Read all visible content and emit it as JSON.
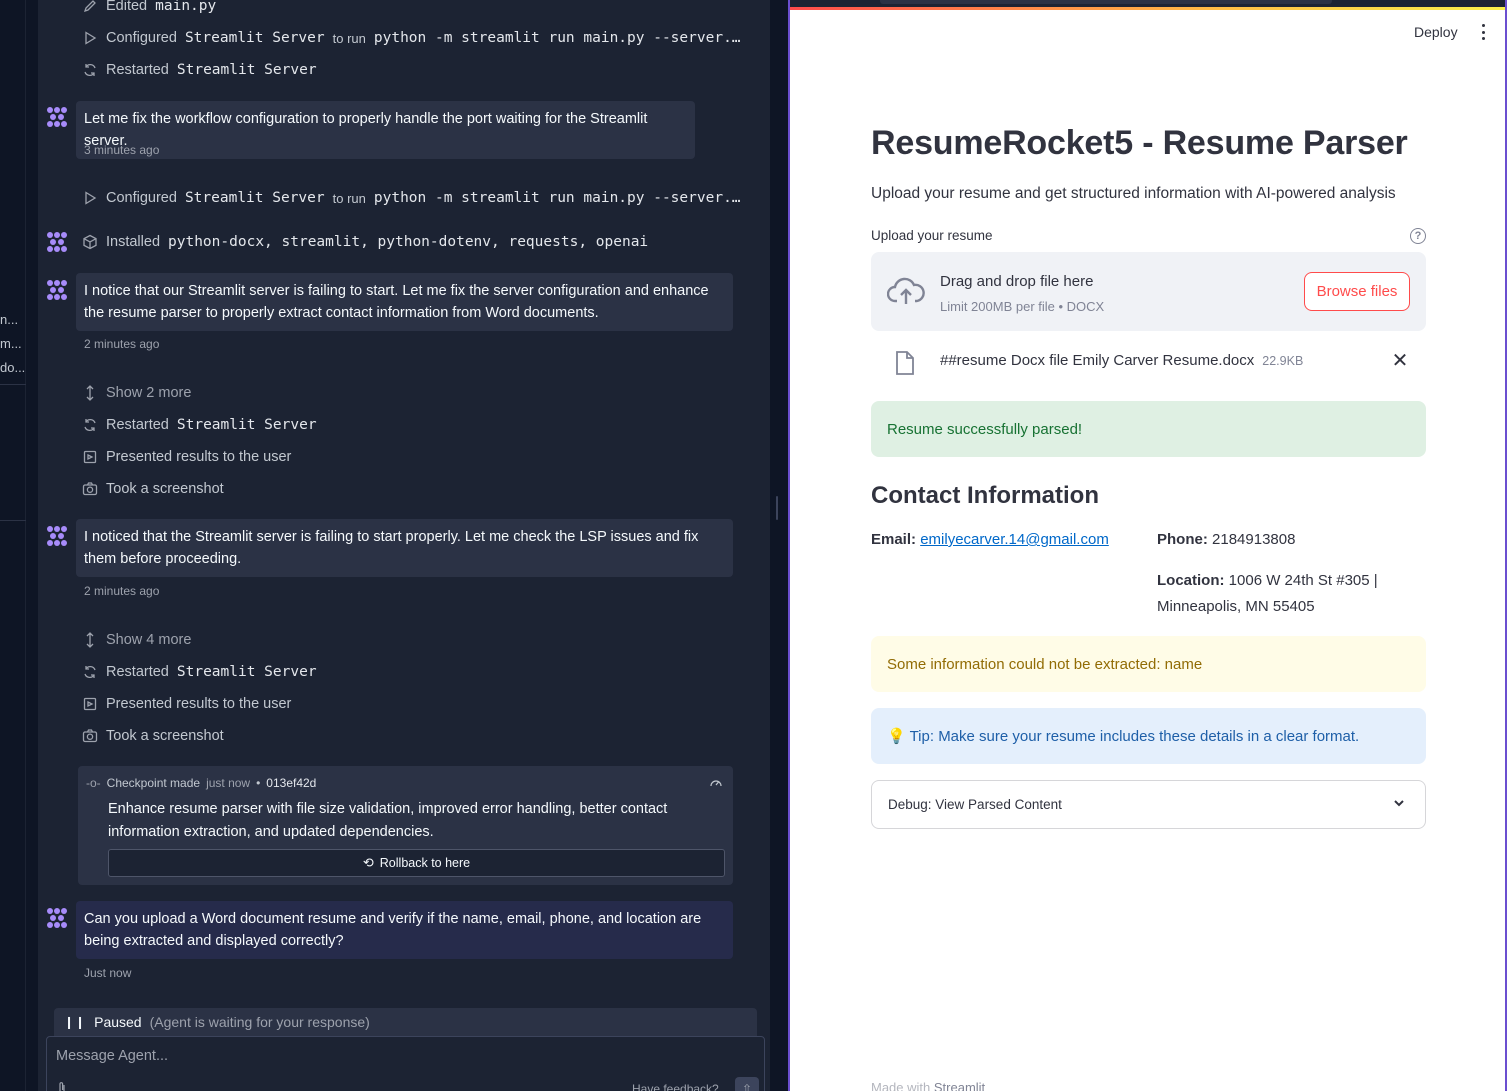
{
  "left_strip": {
    "items": [
      "n...",
      "m...",
      "do..."
    ]
  },
  "agent": {
    "actions_top": [
      {
        "prefix": "Edited",
        "code": "main.py",
        "icon": "pencil-icon"
      },
      {
        "prefix": "Configured",
        "code": "Streamlit Server",
        "mid": "to run",
        "code2": "python -m streamlit run main.py --server.…",
        "icon": "play-icon"
      },
      {
        "prefix": "Restarted",
        "code": "Streamlit Server",
        "icon": "refresh-icon"
      }
    ],
    "msg1": {
      "text": "Let me fix the workflow configuration to properly handle the port waiting for the Streamlit server.",
      "time": "3 minutes ago"
    },
    "action_configured2": {
      "prefix": "Configured",
      "code": "Streamlit Server",
      "mid": "to run",
      "code2": "python -m streamlit run main.py --server.…"
    },
    "installed": {
      "prefix": "Installed",
      "packages": "python-docx, streamlit, python-dotenv, requests, openai"
    },
    "msg2": {
      "text": "I notice that our Streamlit server is failing to start. Let me fix the server configuration and enhance the resume parser to properly extract contact information from Word documents.",
      "time": "2 minutes ago"
    },
    "group1": {
      "show_more": "Show 2 more",
      "restarted_prefix": "Restarted",
      "restarted_code": "Streamlit Server",
      "presented": "Presented results to the user",
      "screenshot": "Took a screenshot"
    },
    "msg3": {
      "text": "I noticed that the Streamlit server is failing to start properly. Let me check the LSP issues and fix them before proceeding.",
      "time": "2 minutes ago"
    },
    "group2": {
      "show_more": "Show 4 more",
      "restarted_prefix": "Restarted",
      "restarted_code": "Streamlit Server",
      "presented": "Presented results to the user",
      "screenshot": "Took a screenshot"
    },
    "checkpoint": {
      "label": "Checkpoint made",
      "when": "just now",
      "dot": "•",
      "hash": "013ef42d",
      "message": "Enhance resume parser with file size validation, improved error handling, better contact information extraction, and updated dependencies.",
      "rollback": "Rollback to here"
    },
    "msg4": {
      "text": "Can you upload a Word document resume and verify if the name, email, phone, and location are being extracted and displayed correctly?",
      "time": "Just now"
    },
    "paused": {
      "label": "Paused",
      "sub": "(Agent is waiting for your response)"
    },
    "input": {
      "placeholder": "Message Agent...",
      "feedback": "Have feedback?"
    }
  },
  "webview": {
    "deploy": "Deploy",
    "title": "ResumeRocket5 - Resume Parser",
    "subtitle": "Upload your resume and get structured information with AI-powered analysis",
    "upload_label": "Upload your resume",
    "help": "?",
    "dropzone": {
      "title": "Drag and drop file here",
      "limit": "Limit 200MB per file • DOCX",
      "browse": "Browse files"
    },
    "file": {
      "name": "##resume Docx file Emily Carver Resume.docx",
      "size": "22.9KB",
      "remove": "✕"
    },
    "success": "Resume successfully parsed!",
    "contact_heading": "Contact Information",
    "email": {
      "label": "Email:",
      "value": "emilyecarver.14@gmail.com"
    },
    "phone": {
      "label": "Phone:",
      "value": "2184913808"
    },
    "location": {
      "label": "Location:",
      "line1": "1006 W 24th St #305 |",
      "line2": "Minneapolis, MN 55405"
    },
    "warning": "Some information could not be extracted: name",
    "tip": "💡 Tip: Make sure your resume includes these details in a clear format.",
    "expander": "Debug: View Parsed Content",
    "footer": {
      "prefix": "Made with",
      "brand": "Streamlit"
    }
  }
}
